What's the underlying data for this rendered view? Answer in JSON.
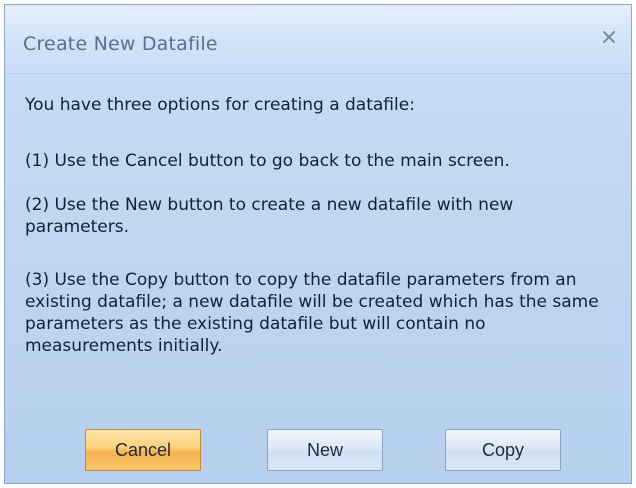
{
  "dialog": {
    "title": "Create New Datafile",
    "close_icon": "close-icon",
    "intro": "You have three options for creating a datafile:",
    "options": [
      "(1) Use the Cancel button to go back to the main screen.",
      "(2) Use the New button to create a new datafile with new parameters.",
      "(3) Use the Copy button to copy the datafile parameters from an existing datafile; a new datafile will be created which has the same parameters as the existing datafile but will contain no measurements initially."
    ],
    "buttons": {
      "cancel": "Cancel",
      "new": "New",
      "copy": "Copy"
    }
  },
  "colors": {
    "dialog_background": "#bfd6f2",
    "title_text": "#5c6f88",
    "body_text": "#10223a",
    "cancel_button": "#fbc96d",
    "default_button": "#dbe7f6"
  }
}
